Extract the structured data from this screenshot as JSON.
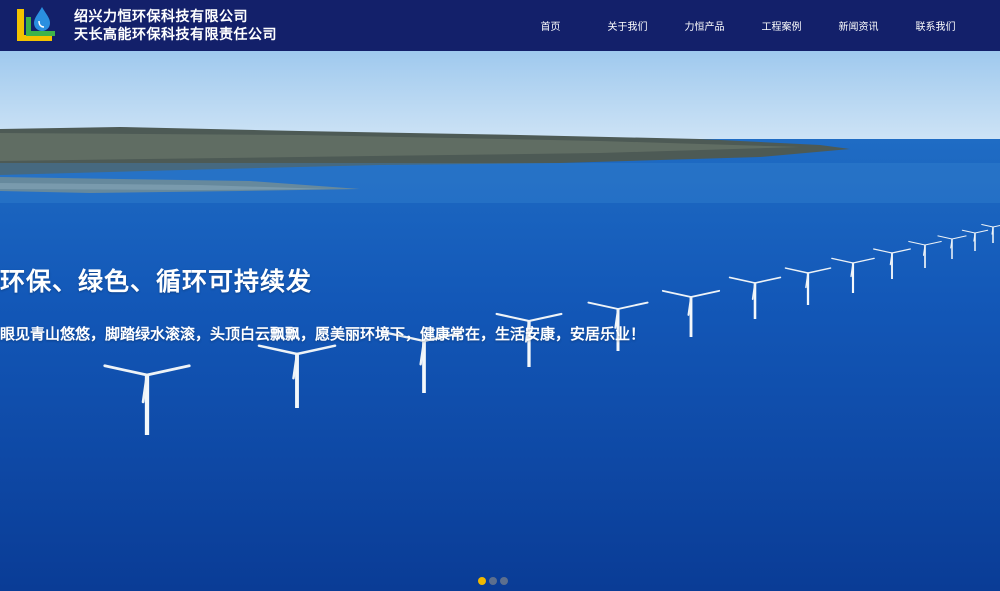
{
  "header": {
    "company_line1": "绍兴力恒环保科技有限公司",
    "company_line2": "天长高能环保科技有限责任公司",
    "logo_icon": "water-drop-logo-icon",
    "background": "#13206a"
  },
  "nav": {
    "items": [
      {
        "label": "首页"
      },
      {
        "label": "关于我们"
      },
      {
        "label": "力恒产品"
      },
      {
        "label": "工程案例"
      },
      {
        "label": "新闻资讯"
      },
      {
        "label": "联系我们"
      }
    ]
  },
  "banner": {
    "headline": "环保、绿色、循环可持续发",
    "subline": "眼见青山悠悠，脚踏绿水滚滚，头顶白云飘飘，愿美丽环境下，健康常在，生活安康，安居乐业！",
    "slide_count": 3,
    "active_slide": 1,
    "colors": {
      "sky": "#aad0f0",
      "sea": "#0d4aa8",
      "active_dot": "#f0b800"
    }
  }
}
